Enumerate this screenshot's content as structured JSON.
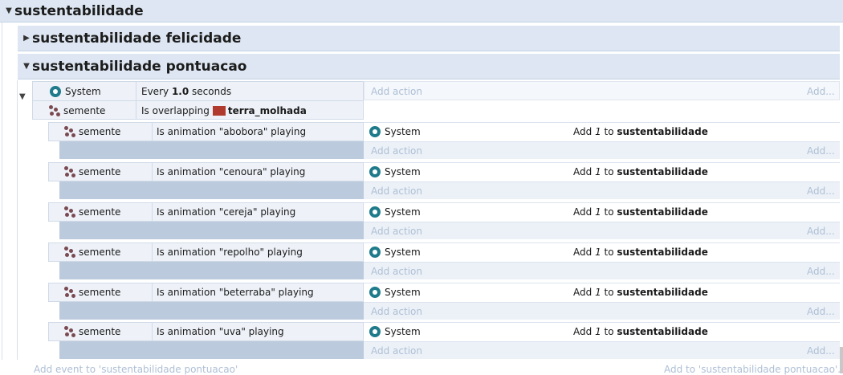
{
  "groups": {
    "root": "sustentabilidade",
    "felicidade": "sustentabilidade felicidade",
    "pontuacao": "sustentabilidade pontuacao"
  },
  "parent_event": {
    "cond1_object": "System",
    "cond1_pre": "Every",
    "cond1_value": "1.0",
    "cond1_post": "seconds",
    "cond2_object": "semente",
    "cond2_text": "Is overlapping",
    "cond2_target": "terra_molhada",
    "add_action": "Add action",
    "add_short": "Add..."
  },
  "subevents": [
    {
      "object": "semente",
      "condition": "Is animation \"abobora\" playing",
      "action_object": "System",
      "action_pre": "Add",
      "action_value": "1",
      "action_to": "to",
      "action_var": "sustentabilidade",
      "add_action": "Add action",
      "add_short": "Add..."
    },
    {
      "object": "semente",
      "condition": "Is animation \"cenoura\" playing",
      "action_object": "System",
      "action_pre": "Add",
      "action_value": "1",
      "action_to": "to",
      "action_var": "sustentabilidade",
      "add_action": "Add action",
      "add_short": "Add..."
    },
    {
      "object": "semente",
      "condition": "Is animation \"cereja\" playing",
      "action_object": "System",
      "action_pre": "Add",
      "action_value": "1",
      "action_to": "to",
      "action_var": "sustentabilidade",
      "add_action": "Add action",
      "add_short": "Add..."
    },
    {
      "object": "semente",
      "condition": "Is animation \"repolho\" playing",
      "action_object": "System",
      "action_pre": "Add",
      "action_value": "1",
      "action_to": "to",
      "action_var": "sustentabilidade",
      "add_action": "Add action",
      "add_short": "Add..."
    },
    {
      "object": "semente",
      "condition": "Is animation \"beterraba\" playing",
      "action_object": "System",
      "action_pre": "Add",
      "action_value": "1",
      "action_to": "to",
      "action_var": "sustentabilidade",
      "add_action": "Add action",
      "add_short": "Add..."
    },
    {
      "object": "semente",
      "condition": "Is animation \"uva\" playing",
      "action_object": "System",
      "action_pre": "Add",
      "action_value": "1",
      "action_to": "to",
      "action_var": "sustentabilidade",
      "add_action": "Add action",
      "add_short": "Add..."
    }
  ],
  "footer": {
    "add_event": "Add event to 'sustentabilidade pontuacao'",
    "add_to": "Add to 'sustentabilidade pontuacao'..."
  },
  "colors": {
    "group_header": "#dde6f2",
    "system_icon": "#1f7b8c",
    "overlap_swatch": "#b03a2e",
    "placeholder_text": "#aebfd4"
  }
}
